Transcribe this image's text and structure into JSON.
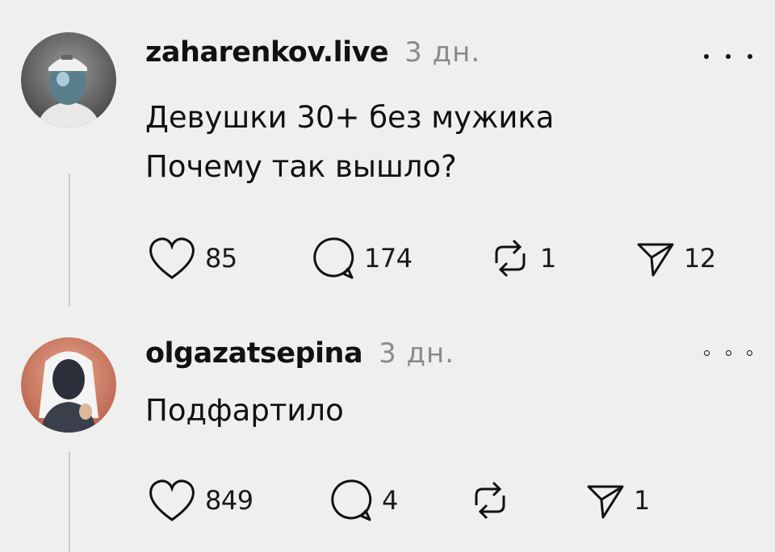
{
  "posts": [
    {
      "username": "zaharenkov.live",
      "time": "3 дн.",
      "lines": [
        "Девушки 30+ без мужика",
        "Почему так вышло?"
      ],
      "actions": {
        "likes": "85",
        "comments": "174",
        "reposts": "1",
        "shares": "12"
      }
    },
    {
      "username": "olgazatsepina",
      "time": "3 дн.",
      "lines": [
        "Подфартило"
      ],
      "actions": {
        "likes": "849",
        "comments": "4",
        "reposts": "",
        "shares": "1"
      }
    }
  ],
  "icons": {
    "like": "heart-icon",
    "comment": "speech-bubble-icon",
    "repost": "repost-arrows-icon",
    "share": "paper-plane-icon",
    "more": "more-dots-icon"
  }
}
